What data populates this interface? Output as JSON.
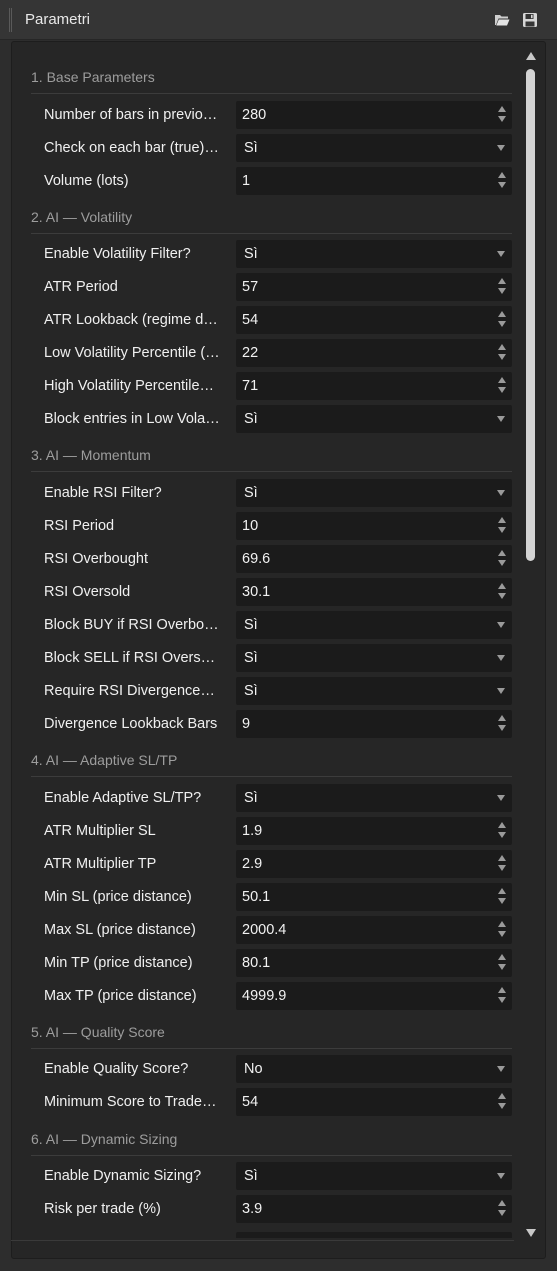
{
  "window": {
    "title": "Parametri"
  },
  "toolbar": {
    "open_icon": "folder-open-icon",
    "save_icon": "save-icon"
  },
  "sections": [
    {
      "label": "1. Base Parameters",
      "rows": [
        {
          "name": "Number of bars in previo…",
          "value": "280",
          "kind": "spin"
        },
        {
          "name": "Check on each bar (true)…",
          "value": "Sì",
          "kind": "select"
        },
        {
          "name": "Volume (lots)",
          "value": "1",
          "kind": "spin"
        }
      ]
    },
    {
      "label": "2. AI — Volatility",
      "rows": [
        {
          "name": "Enable Volatility Filter?",
          "value": "Sì",
          "kind": "select"
        },
        {
          "name": "ATR Period",
          "value": "57",
          "kind": "spin"
        },
        {
          "name": "ATR Lookback (regime d…",
          "value": "54",
          "kind": "spin"
        },
        {
          "name": "Low Volatility Percentile (…",
          "value": "22",
          "kind": "spin"
        },
        {
          "name": "High Volatility Percentile…",
          "value": "71",
          "kind": "spin"
        },
        {
          "name": "Block entries in Low Vola…",
          "value": "Sì",
          "kind": "select"
        }
      ]
    },
    {
      "label": "3. AI — Momentum",
      "rows": [
        {
          "name": "Enable RSI Filter?",
          "value": "Sì",
          "kind": "select"
        },
        {
          "name": "RSI Period",
          "value": "10",
          "kind": "spin"
        },
        {
          "name": "RSI Overbought",
          "value": "69.6",
          "kind": "spin"
        },
        {
          "name": "RSI Oversold",
          "value": "30.1",
          "kind": "spin"
        },
        {
          "name": "Block BUY if RSI Overbo…",
          "value": "Sì",
          "kind": "select"
        },
        {
          "name": "Block SELL if RSI Overs…",
          "value": "Sì",
          "kind": "select"
        },
        {
          "name": "Require RSI Divergence…",
          "value": "Sì",
          "kind": "select"
        },
        {
          "name": "Divergence Lookback Bars",
          "value": "9",
          "kind": "spin"
        }
      ]
    },
    {
      "label": "4. AI — Adaptive SL/TP",
      "rows": [
        {
          "name": "Enable Adaptive SL/TP?",
          "value": "Sì",
          "kind": "select"
        },
        {
          "name": "ATR Multiplier SL",
          "value": "1.9",
          "kind": "spin"
        },
        {
          "name": "ATR Multiplier TP",
          "value": "2.9",
          "kind": "spin"
        },
        {
          "name": "Min SL (price distance)",
          "value": "50.1",
          "kind": "spin"
        },
        {
          "name": "Max SL (price distance)",
          "value": "2000.4",
          "kind": "spin"
        },
        {
          "name": "Min TP (price distance)",
          "value": "80.1",
          "kind": "spin"
        },
        {
          "name": "Max TP (price distance)",
          "value": "4999.9",
          "kind": "spin"
        }
      ]
    },
    {
      "label": "5. AI — Quality Score",
      "rows": [
        {
          "name": "Enable Quality Score?",
          "value": "No",
          "kind": "select"
        },
        {
          "name": "Minimum Score to Trade…",
          "value": "54",
          "kind": "spin"
        }
      ]
    },
    {
      "label": "6. AI — Dynamic Sizing",
      "rows": [
        {
          "name": "Enable Dynamic Sizing?",
          "value": "Sì",
          "kind": "select"
        },
        {
          "name": "Risk per trade (%)",
          "value": "3.9",
          "kind": "spin"
        }
      ]
    }
  ],
  "scrollbar": {
    "up_icon": "scroll-up-arrow-icon",
    "down_icon": "scroll-down-arrow-icon",
    "visible_fraction": 0.42,
    "position": 0
  }
}
